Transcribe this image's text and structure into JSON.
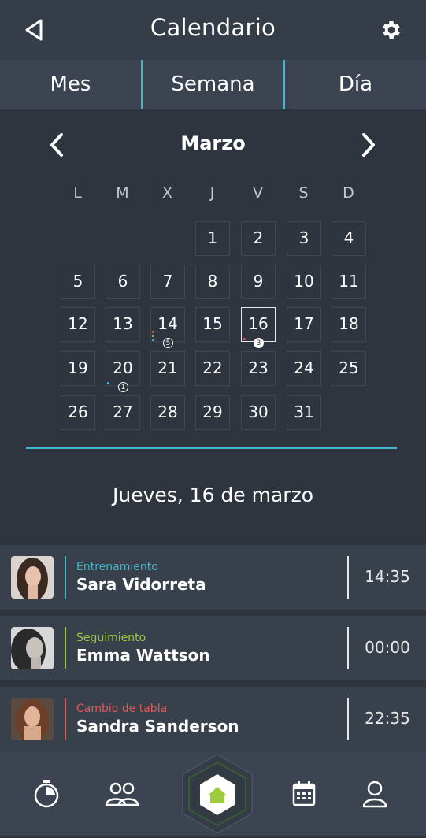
{
  "header": {
    "title": "Calendario",
    "back_icon": "back-triangle-icon",
    "settings_icon": "gear-icon"
  },
  "tabs": [
    {
      "label": "Mes"
    },
    {
      "label": "Semana"
    },
    {
      "label": "Día"
    }
  ],
  "calendar": {
    "month": "Marzo",
    "weekdays": [
      "L",
      "M",
      "X",
      "J",
      "V",
      "S",
      "D"
    ],
    "weeks": [
      [
        "",
        "",
        "",
        "1",
        "2",
        "3",
        "4"
      ],
      [
        "5",
        "6",
        "7",
        "8",
        "9",
        "10",
        "11"
      ],
      [
        "12",
        "13",
        "14",
        "15",
        "16",
        "17",
        "18"
      ],
      [
        "19",
        "20",
        "21",
        "22",
        "23",
        "24",
        "25"
      ],
      [
        "26",
        "27",
        "28",
        "29",
        "30",
        "31",
        ""
      ]
    ],
    "selected_day": "16",
    "event_badges": [
      {
        "day": "14",
        "count": "5",
        "dot_colors": [
          "#e05a5a",
          "#9ccc3c",
          "#3fb8c9"
        ]
      },
      {
        "day": "16",
        "count": "3",
        "dot_colors": [
          "#e05a5a"
        ]
      },
      {
        "day": "20",
        "count": "1",
        "dot_colors": [
          "#3fb8c9"
        ]
      }
    ]
  },
  "selected_date_label": "Jueves, 16 de marzo",
  "events": [
    {
      "type": "Entrenamiento",
      "name": "Sara Vidorreta",
      "time": "14:35",
      "color": "#3fb8c9"
    },
    {
      "type": "Seguimiento",
      "name": "Emma Wattson",
      "time": "00:00",
      "color": "#9ccc3c"
    },
    {
      "type": "Cambio de tabla",
      "name": "Sandra Sanderson",
      "time": "22:35",
      "color": "#e05a5a"
    }
  ],
  "bottom_nav": [
    {
      "icon": "stopwatch-icon"
    },
    {
      "icon": "users-icon"
    },
    {
      "icon": "home-icon",
      "active": true
    },
    {
      "icon": "calendar-icon"
    },
    {
      "icon": "user-icon"
    }
  ],
  "colors": {
    "accent": "#3fb8c9",
    "green": "#9ccc3c",
    "red": "#e05a5a",
    "background": "#2e353f"
  }
}
